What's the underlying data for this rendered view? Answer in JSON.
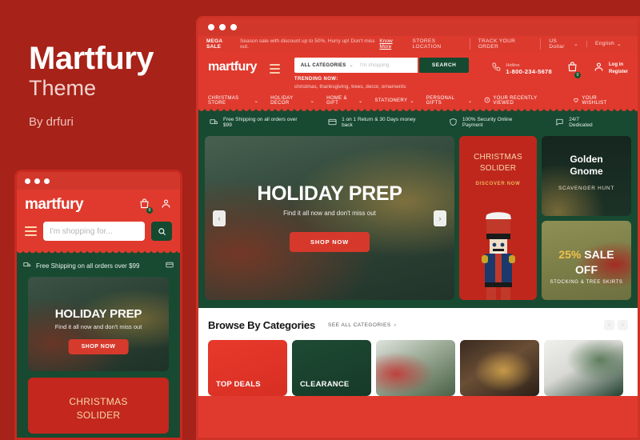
{
  "brand": {
    "title": "Martfury",
    "subtitle": "Theme",
    "author": "By drfuri"
  },
  "mobile": {
    "logo": "martfury",
    "search_placeholder": "I'm shopping for...",
    "cart_badge": "0",
    "shipping_text": "Free Shipping on all orders over $99",
    "hero": {
      "title": "HOLIDAY PREP",
      "subtitle": "Find it all now and don't miss out",
      "button": "SHOP NOW"
    },
    "promo": {
      "line1": "CHRISTMAS",
      "line2": "SOLIDER"
    }
  },
  "desktop": {
    "topbar": {
      "mega_label": "MEGA SALE",
      "message": "Season sale with discount up to 50%, Hurry up! Don't miss out.",
      "know_more": "Know More",
      "links": [
        {
          "label": "STORES LOCATION",
          "caret": false
        },
        {
          "label": "TRACK YOUR ORDER",
          "caret": false
        },
        {
          "label": "US Dollar",
          "caret": true
        },
        {
          "label": "English",
          "caret": true
        }
      ]
    },
    "header": {
      "logo": "martfury",
      "categories_label": "ALL CATEGORIES",
      "search_placeholder": "I'm shopping",
      "search_button": "SEARCH",
      "trending_label": "TRENDING NOW:",
      "trending_items": "christmas,  thanksgiving,  trees,  decor,  ornaments",
      "hotline_label": "Hotline",
      "hotline_number": "1-800-234-5678",
      "cart_badge": "0",
      "account_line1": "Log in",
      "account_line2": "Register"
    },
    "nav": {
      "items": [
        {
          "label": "CHRISTMAS STORE",
          "caret": true
        },
        {
          "label": "HOLIDAY DECOR",
          "caret": true
        },
        {
          "label": "HOME & GIFT",
          "caret": true
        },
        {
          "label": "STATIONERY",
          "caret": true
        },
        {
          "label": "PERSONAL GIFTS",
          "caret": true
        }
      ],
      "right": [
        {
          "label": "YOUR RECENTLY VIEWED",
          "icon": "clock-icon"
        },
        {
          "label": "YOUR WISHLIST",
          "icon": "heart-icon"
        }
      ]
    },
    "features": [
      {
        "icon": "truck-icon",
        "label": "Free Shipping on all orders over $99"
      },
      {
        "icon": "card-icon",
        "label": "1 on 1 Return & 30 Days money back"
      },
      {
        "icon": "shield-icon",
        "label": "100% Security Online Payment"
      },
      {
        "icon": "chat-icon",
        "label": "24/7 Dedicated"
      }
    ],
    "hero": {
      "title": "HOLIDAY PREP",
      "subtitle": "Find it all now and don't miss out",
      "button": "SHOP NOW"
    },
    "promos": {
      "soldier": {
        "line1": "CHRISTMAS",
        "line2": "SOLIDER",
        "cta": "DISCOVER NOW"
      },
      "gnome": {
        "line1": "Golden",
        "line2": "Gnome",
        "sub": "SCAVENGER HUNT"
      },
      "sale": {
        "line1_pct": "25%",
        "line1_rest": " SALE",
        "line2": "OFF",
        "sub": "STOCKING & TREE SKIRTS"
      }
    },
    "categories_section": {
      "title": "Browse By Categories",
      "see_all": "SEE ALL CATEGORIES",
      "prev": "‹",
      "next": "›",
      "items": [
        {
          "label": "TOP DEALS",
          "style": "cat-red"
        },
        {
          "label": "CLEARANCE",
          "style": "cat-green"
        },
        {
          "label": "",
          "style": "cat-p1"
        },
        {
          "label": "",
          "style": "cat-p2"
        },
        {
          "label": "",
          "style": "cat-p3"
        }
      ]
    }
  },
  "colors": {
    "page_bg": "#a72218",
    "brand_red": "#e03a2e",
    "deep_green": "#174a31",
    "promo_red": "#bf271d",
    "gold": "#eab35a"
  }
}
